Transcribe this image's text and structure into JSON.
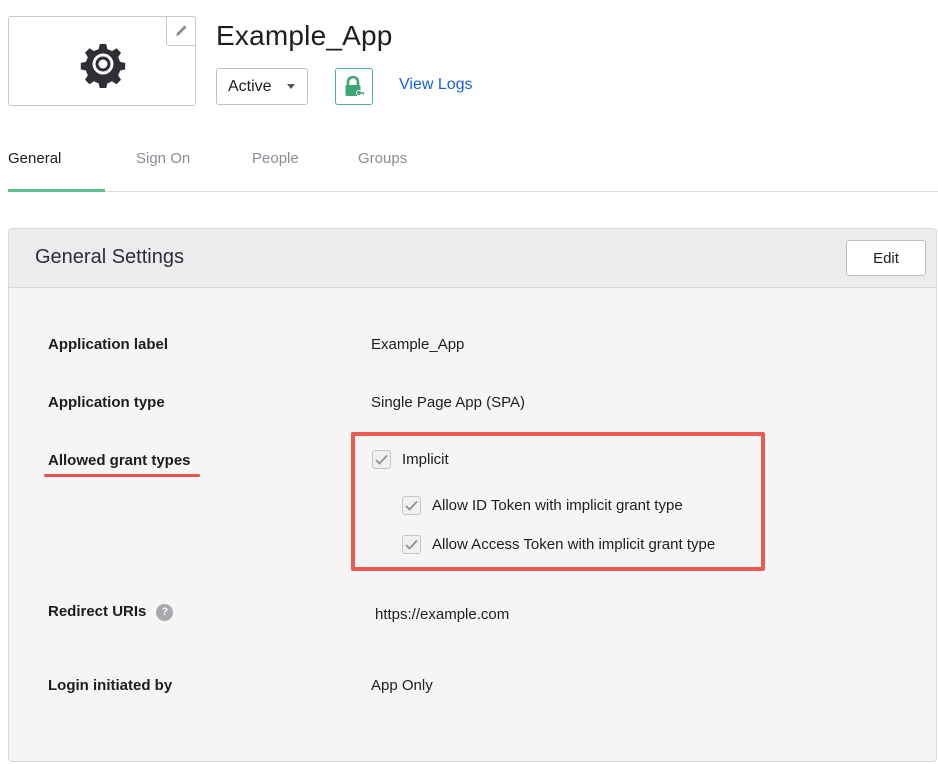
{
  "app": {
    "name": "Example_App",
    "status": "Active",
    "view_logs_label": "View Logs",
    "logo_icon": "gear-icon",
    "edit_logo_icon": "pencil-icon",
    "push_icon": "lock-key-icon"
  },
  "tabs": [
    {
      "label": "General",
      "active": true
    },
    {
      "label": "Sign On",
      "active": false
    },
    {
      "label": "People",
      "active": false
    },
    {
      "label": "Groups",
      "active": false
    }
  ],
  "settings": {
    "title": "General Settings",
    "edit_label": "Edit",
    "rows": {
      "application_label": {
        "label": "Application label",
        "value": "Example_App"
      },
      "application_type": {
        "label": "Application type",
        "value": "Single Page App (SPA)"
      },
      "grant_types": {
        "label": "Allowed grant types",
        "options": [
          {
            "label": "Implicit",
            "checked": true
          },
          {
            "label": "Allow ID Token with implicit grant type",
            "checked": true
          },
          {
            "label": "Allow Access Token with implicit grant type",
            "checked": true
          }
        ]
      },
      "redirect_uris": {
        "label": "Redirect URIs",
        "help": "?",
        "value": "https://example.com"
      },
      "login_initiated_by": {
        "label": "Login initiated by",
        "value": "App Only"
      }
    }
  },
  "colors": {
    "accent_green": "#5ec08f",
    "link_blue": "#1662dd",
    "highlight_red": "#ea5a50"
  }
}
